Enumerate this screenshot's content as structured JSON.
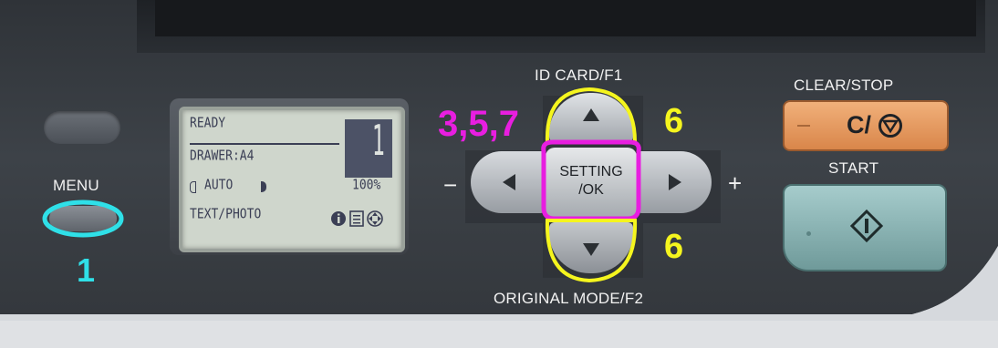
{
  "labels": {
    "menu": "MENU",
    "id_card": "ID CARD/F1",
    "original_mode": "ORIGINAL MODE/F2",
    "clear_stop": "CLEAR/STOP",
    "clear_stop_symbol": "C/",
    "start": "START",
    "minus": "−",
    "plus": "+"
  },
  "lcd": {
    "line1": "READY",
    "line2": "DRAWER:A4",
    "line3_mode": "AUTO",
    "line3_zoom": "100%",
    "line4": "TEXT/PHOTO",
    "copies": "1"
  },
  "center_button": {
    "line1": "SETTING",
    "line2": "/OK"
  },
  "annotations": {
    "step_menu": "1",
    "step_setting": "3,5,7",
    "step_up": "6",
    "step_down": "6"
  },
  "colors": {
    "annotation_cyan": "#2fe0e8",
    "annotation_magenta": "#e81ee0",
    "annotation_yellow": "#f5f51e",
    "clear_stop_orange": "#e99a5c",
    "start_teal": "#8fb8b8",
    "panel_dark": "#3a3f45"
  },
  "icons": [
    "up-arrow-icon",
    "down-arrow-icon",
    "left-arrow-icon",
    "right-arrow-icon",
    "stop-icon",
    "start-diamond-icon",
    "info-icon",
    "list-icon",
    "navigation-icon"
  ]
}
